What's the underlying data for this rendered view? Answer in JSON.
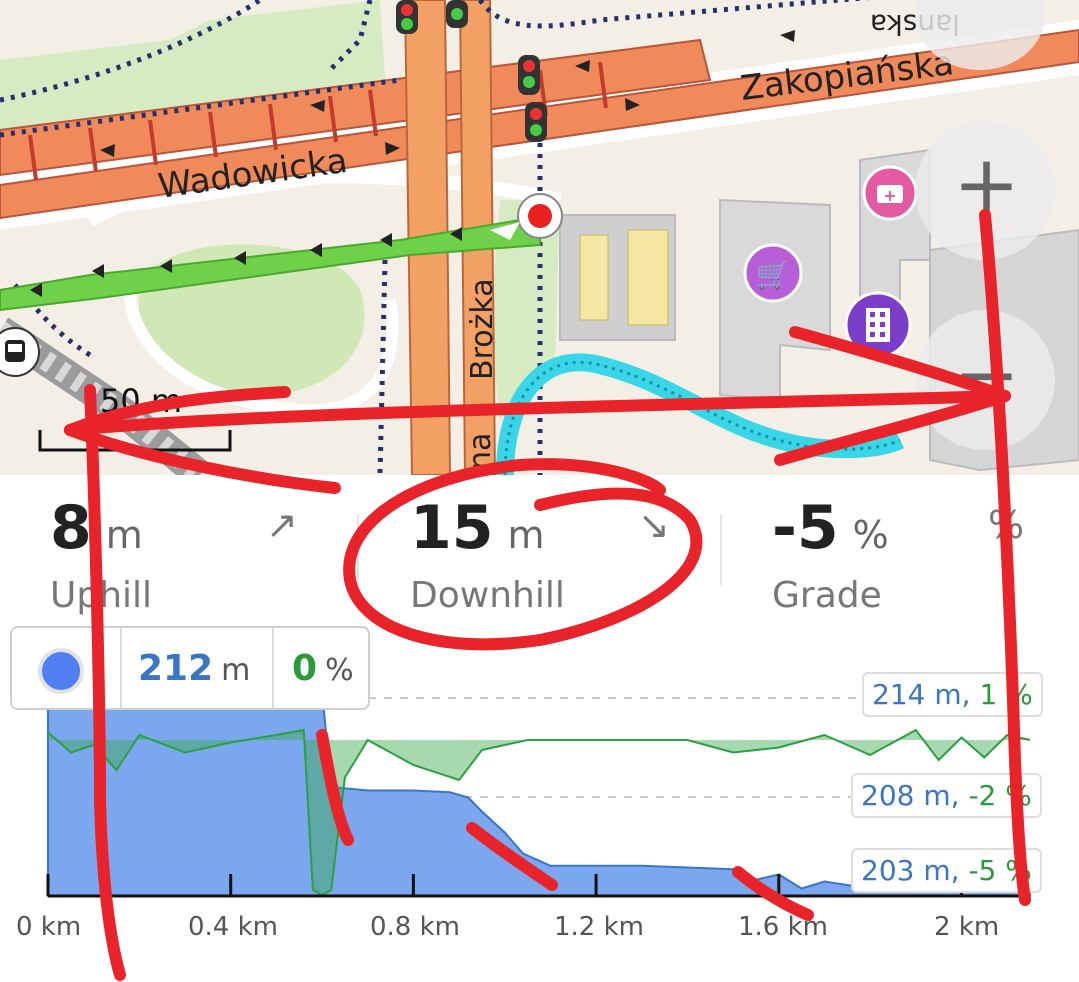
{
  "map": {
    "streets": {
      "zakopianska": "Zakopiańska",
      "wadowicka": "Wadowicka",
      "brozka": "Brożka",
      "partial_name": "na",
      "overflow_label": "lanska"
    },
    "scale_label": "50 m",
    "controls": {
      "zoom_in": "+",
      "zoom_out": "−"
    },
    "poi_icons": [
      "shopping-cart-icon",
      "pharmacy-icon",
      "office-building-icon",
      "bus-stop-icon",
      "traffic-light-icon"
    ],
    "colors": {
      "route": "#6fd14a",
      "primary_road": "#f08a5a",
      "secondary_road": "#f2a063",
      "cycleway": "#39d6e8",
      "background": "#f3efe6"
    }
  },
  "stats": [
    {
      "value": "8",
      "unit": "m",
      "label": "Uphill",
      "arrow": "↗"
    },
    {
      "value": "15",
      "unit": "m",
      "label": "Downhill",
      "arrow": "↘"
    },
    {
      "value": "-5",
      "unit": "%",
      "label": "Grade",
      "arrow": "%"
    }
  ],
  "current": {
    "elevation": "212",
    "elevation_unit": "m",
    "grade": "0",
    "grade_unit": "%",
    "accent": "#3a76c4",
    "grade_color": "#2a9a3a"
  },
  "chart_data": {
    "type": "area",
    "x_unit": "km",
    "x_ticks": [
      "0 km",
      "0.4 km",
      "0.8 km",
      "1.2 km",
      "1.6 km",
      "2 km"
    ],
    "xlim": [
      0,
      2.15
    ],
    "gridline_labels": [
      {
        "elevation": "214 m",
        "grade": "1 %"
      },
      {
        "elevation": "208 m",
        "grade": "-2 %"
      },
      {
        "elevation": "203 m",
        "grade": "-5 %"
      }
    ],
    "series": [
      {
        "name": "elevation",
        "unit": "m",
        "color": "#7aa7ee",
        "x": [
          0,
          0.05,
          0.12,
          0.2,
          0.28,
          0.35,
          0.45,
          0.55,
          0.6,
          0.62,
          0.7,
          0.8,
          0.88,
          0.92,
          0.95,
          1.0,
          1.04,
          1.1,
          1.2,
          1.3,
          1.4,
          1.5,
          1.55,
          1.6,
          1.65,
          1.7,
          1.8,
          1.9,
          2.0,
          2.05,
          2.15
        ],
        "values": [
          214,
          214.3,
          214.3,
          213.9,
          214.0,
          213.8,
          214.1,
          214.2,
          214.3,
          208.8,
          208.6,
          208.6,
          208.5,
          208.2,
          207.4,
          206.2,
          205.0,
          204.3,
          204.3,
          204.3,
          204.2,
          204.1,
          203.5,
          203.8,
          203.0,
          203.4,
          203.0,
          203.0,
          203.0,
          203.2,
          203.0
        ]
      },
      {
        "name": "grade",
        "unit": "%",
        "color": "#2aa040",
        "x": [
          0,
          0.05,
          0.1,
          0.15,
          0.2,
          0.3,
          0.4,
          0.5,
          0.56,
          0.58,
          0.6,
          0.62,
          0.65,
          0.7,
          0.8,
          0.9,
          0.95,
          1.0,
          1.05,
          1.2,
          1.4,
          1.5,
          1.6,
          1.7,
          1.8,
          1.9,
          1.95,
          2.0,
          2.05,
          2.1,
          2.15
        ],
        "values": [
          0.3,
          -0.5,
          -0.2,
          -1.2,
          0.2,
          -0.5,
          -0.1,
          0.2,
          0.4,
          -6.0,
          -6.2,
          -6.0,
          -1.5,
          0.0,
          -1.0,
          -1.6,
          -0.4,
          -0.2,
          0.0,
          0.0,
          0.0,
          -0.5,
          -0.3,
          0.2,
          -0.6,
          0.4,
          -0.8,
          0.1,
          -0.7,
          0.2,
          0.0
        ]
      }
    ]
  }
}
